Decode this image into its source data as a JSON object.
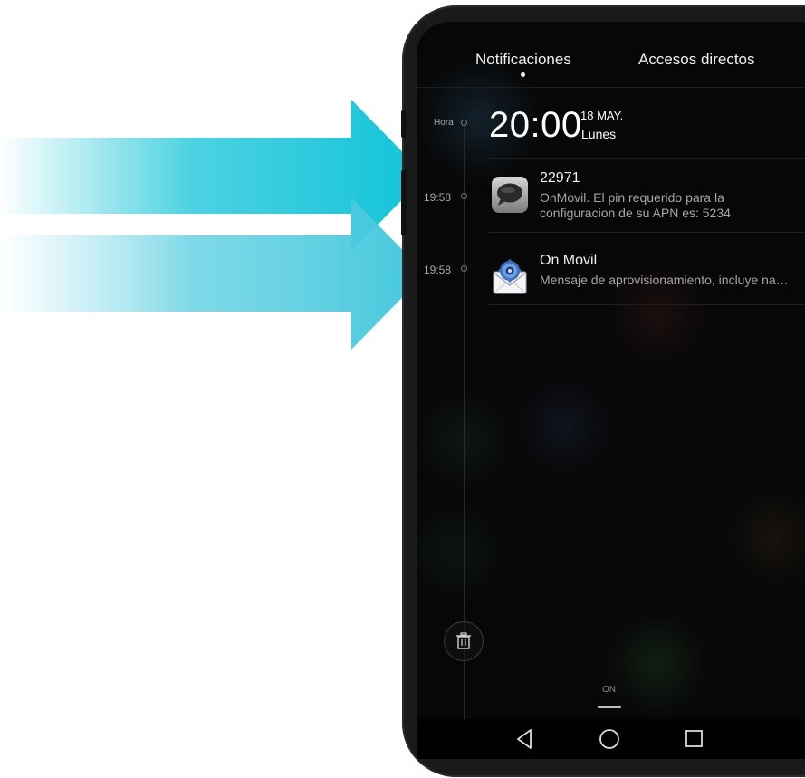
{
  "colors": {
    "arrow_cyan": "#11c3d8",
    "arrow_light": "#7fd8e8",
    "phone_body": "#1a1a1a",
    "screen_bg": "#070707"
  },
  "tabs": {
    "notifications": "Notificaciones",
    "shortcuts": "Accesos directos",
    "active": "notifications"
  },
  "clock": {
    "time_label": "Hora",
    "time": "20:00",
    "date": "18 MAY.",
    "weekday": "Lunes"
  },
  "notifications": [
    {
      "time": "19:58",
      "icon": "speech-bubble-icon",
      "title": "22971",
      "body": "OnMovil. El pin requerido para la configuracion de su APN es: 5234"
    },
    {
      "time": "19:58",
      "icon": "envelope-gear-icon",
      "title": "On Movil",
      "body": "Mensaje de aprovisionamiento, incluye nam…"
    }
  ],
  "footer": {
    "on_label": "ON"
  },
  "icons": {
    "trash": "trash-icon",
    "back": "back-triangle-icon",
    "home": "home-circle-icon",
    "recent": "recent-square-icon"
  }
}
